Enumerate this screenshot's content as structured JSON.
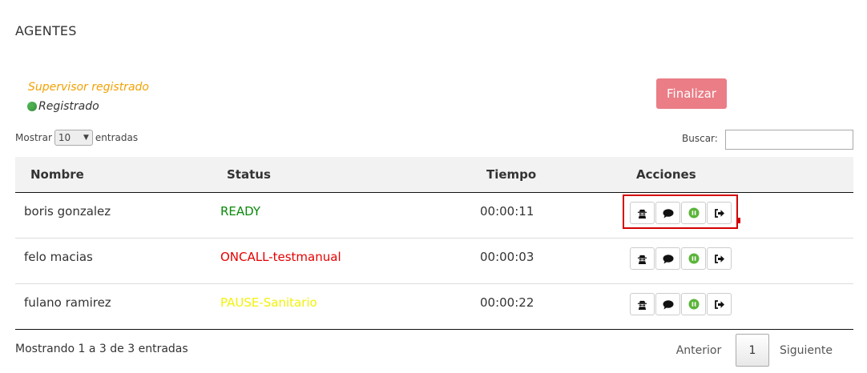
{
  "page": {
    "title": "AGENTES"
  },
  "supervisor": {
    "label": "Supervisor registrado",
    "status": "Registrado"
  },
  "finalize_button": "Finalizar",
  "length_control": {
    "prefix": "Mostrar",
    "value": "10",
    "suffix": "entradas"
  },
  "search": {
    "label": "Buscar:",
    "value": ""
  },
  "table": {
    "headers": [
      "Nombre",
      "Status",
      "Tiempo",
      "Acciones"
    ],
    "rows": [
      {
        "name": "boris gonzalez",
        "status": "READY",
        "status_color": "#0a8a0a",
        "time": "00:00:11"
      },
      {
        "name": "felo macias",
        "status": "ONCALL-testmanual",
        "status_color": "#e60000",
        "time": "00:00:03"
      },
      {
        "name": "fulano ramirez",
        "status": "PAUSE-Sanitario",
        "status_color": "#f2f20a",
        "time": "00:00:22"
      }
    ],
    "action_icons": [
      "spy-icon",
      "chat-icon",
      "pause-icon",
      "logout-icon"
    ]
  },
  "footer": {
    "info": "Mostrando 1 a 3 de 3 entradas",
    "prev": "Anterior",
    "current_page": "1",
    "next": "Siguiente"
  }
}
